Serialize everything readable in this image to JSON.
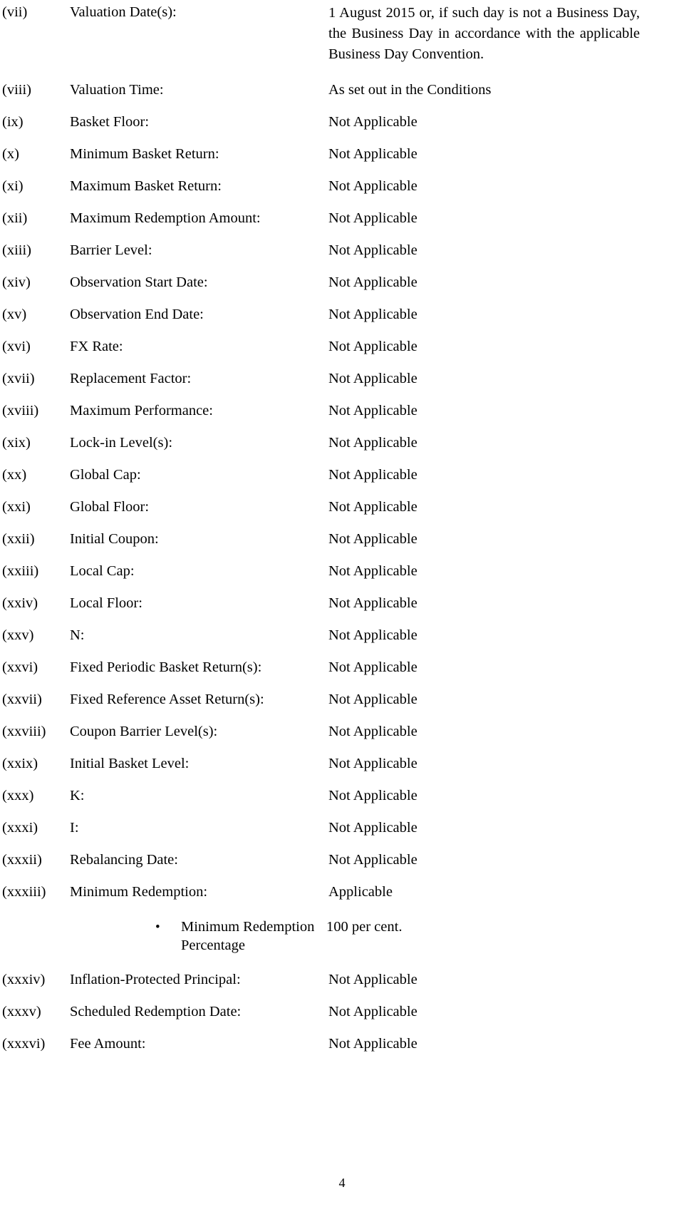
{
  "document": {
    "page_number": "4",
    "bullet_glyph": "•"
  },
  "rows": [
    {
      "numeral": "(vii)",
      "label": "Valuation Date(s):",
      "value": "1 August 2015 or, if such day is not a Business Day, the Business Day in accordance with the applicable Business Day Convention.",
      "style": "justify"
    },
    {
      "numeral": "(viii)",
      "label": "Valuation Time:",
      "value": "As set out in the Conditions"
    },
    {
      "numeral": "(ix)",
      "label": "Basket Floor:",
      "value": "Not Applicable"
    },
    {
      "numeral": "(x)",
      "label": "Minimum Basket Return:",
      "value": "Not Applicable"
    },
    {
      "numeral": "(xi)",
      "label": "Maximum Basket Return:",
      "value": "Not Applicable"
    },
    {
      "numeral": "(xii)",
      "label": "Maximum Redemption Amount:",
      "value": "Not Applicable"
    },
    {
      "numeral": "(xiii)",
      "label": "Barrier Level:",
      "value": "Not Applicable"
    },
    {
      "numeral": "(xiv)",
      "label": "Observation Start Date:",
      "value": "Not Applicable"
    },
    {
      "numeral": "(xv)",
      "label": "Observation End Date:",
      "value": "Not Applicable"
    },
    {
      "numeral": "(xvi)",
      "label": "FX Rate:",
      "value": "Not Applicable"
    },
    {
      "numeral": "(xvii)",
      "label": "Replacement Factor:",
      "value": "Not Applicable"
    },
    {
      "numeral": "(xviii)",
      "label": "Maximum Performance:",
      "value": "Not Applicable"
    },
    {
      "numeral": "(xix)",
      "label": "Lock-in Level(s):",
      "value": "Not Applicable"
    },
    {
      "numeral": "(xx)",
      "label": "Global Cap:",
      "value": "Not Applicable"
    },
    {
      "numeral": "(xxi)",
      "label": "Global Floor:",
      "value": "Not Applicable"
    },
    {
      "numeral": "(xxii)",
      "label": "Initial Coupon:",
      "value": "Not Applicable"
    },
    {
      "numeral": "(xxiii)",
      "label": "Local Cap:",
      "value": "Not Applicable"
    },
    {
      "numeral": "(xxiv)",
      "label": "Local Floor:",
      "value": "Not Applicable"
    },
    {
      "numeral": "(xxv)",
      "label": "N:",
      "value": "Not Applicable"
    },
    {
      "numeral": "(xxvi)",
      "label": "Fixed Periodic Basket Return(s):",
      "value": "Not Applicable"
    },
    {
      "numeral": "(xxvii)",
      "label": "Fixed Reference Asset Return(s):",
      "value": "Not Applicable"
    },
    {
      "numeral": "(xxviii)",
      "label": "Coupon Barrier Level(s):",
      "value": "Not Applicable"
    },
    {
      "numeral": "(xxix)",
      "label": "Initial Basket Level:",
      "value": "Not Applicable"
    },
    {
      "numeral": "(xxx)",
      "label": "K:",
      "value": "Not Applicable"
    },
    {
      "numeral": "(xxxi)",
      "label": "I:",
      "value": "Not Applicable"
    },
    {
      "numeral": "(xxxii)",
      "label": "Rebalancing Date:",
      "value": "Not Applicable"
    },
    {
      "numeral": "(xxxiii)",
      "label": "Minimum Redemption:",
      "value": "Applicable"
    }
  ],
  "bullet_item": {
    "label": "Minimum Redemption Percentage",
    "value": "100 per cent."
  },
  "rows_after_bullet": [
    {
      "numeral": "(xxxiv)",
      "label": "Inflation-Protected Principal:",
      "value": "Not Applicable"
    },
    {
      "numeral": "(xxxv)",
      "label": "Scheduled Redemption Date:",
      "value": "Not Applicable"
    },
    {
      "numeral": "(xxxvi)",
      "label": "Fee Amount:",
      "value": "Not Applicable"
    }
  ]
}
